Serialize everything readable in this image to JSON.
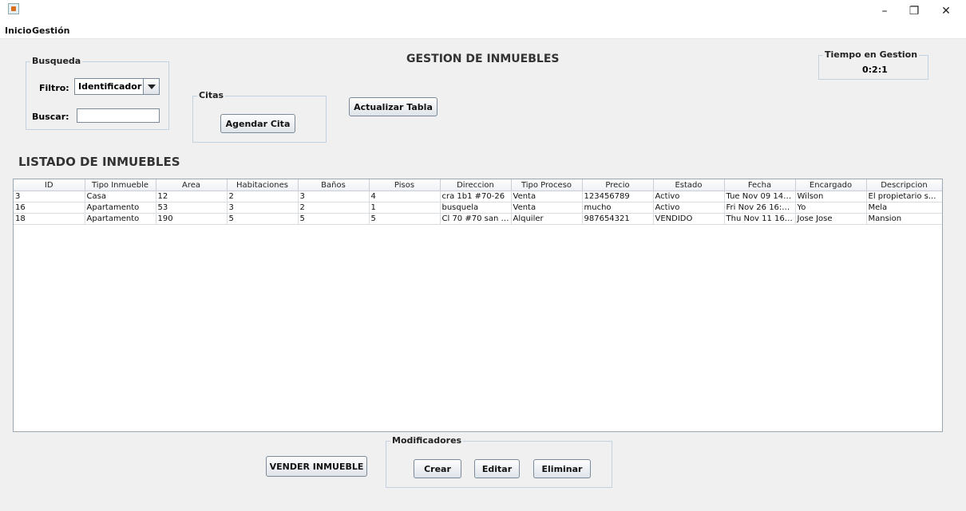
{
  "window": {
    "minimize": "–",
    "maximize": "❐",
    "close": "✕"
  },
  "menu": [
    "Inicio",
    "Gestión"
  ],
  "search": {
    "legend": "Busqueda",
    "filter_label": "Filtro:",
    "filter_value": "Identificador",
    "search_label": "Buscar:",
    "search_value": ""
  },
  "citas": {
    "legend": "Citas",
    "button": "Agendar Cita"
  },
  "refresh_button": "Actualizar Tabla",
  "page_title": "GESTION DE INMUEBLES",
  "timer": {
    "legend": "Tiempo en Gestion",
    "value": "0:2:1"
  },
  "list_title": "LISTADO DE INMUEBLES",
  "table": {
    "columns": [
      "ID",
      "Tipo Inmueble",
      "Area",
      "Habitaciones",
      "Baños",
      "Pisos",
      "Direccion",
      "Tipo Proceso",
      "Precio",
      "Estado",
      "Fecha",
      "Encargado",
      "Descripcion"
    ],
    "rows": [
      [
        "3",
        "Casa",
        "12",
        "2",
        "3",
        "4",
        "cra 1b1 #70-26",
        "Venta",
        "123456789",
        "Activo",
        "Tue Nov 09 14:3...",
        "Wilson",
        "El propietario s..."
      ],
      [
        "16",
        "Apartamento",
        "53",
        "3",
        "2",
        "1",
        "busquela",
        "Venta",
        "mucho",
        "Activo",
        "Fri Nov 26 16:16...",
        "Yo",
        "Mela"
      ],
      [
        "18",
        "Apartamento",
        "190",
        "5",
        "5",
        "5",
        "Cl 70 #70 san l...",
        "Alquiler",
        "987654321",
        "VENDIDO",
        "Thu Nov 11 16:0...",
        "Jose Jose",
        "Mansion"
      ]
    ]
  },
  "sell_button": "VENDER INMUEBLE",
  "modificadores": {
    "legend": "Modificadores",
    "create": "Crear",
    "edit": "Editar",
    "delete": "Eliminar"
  }
}
